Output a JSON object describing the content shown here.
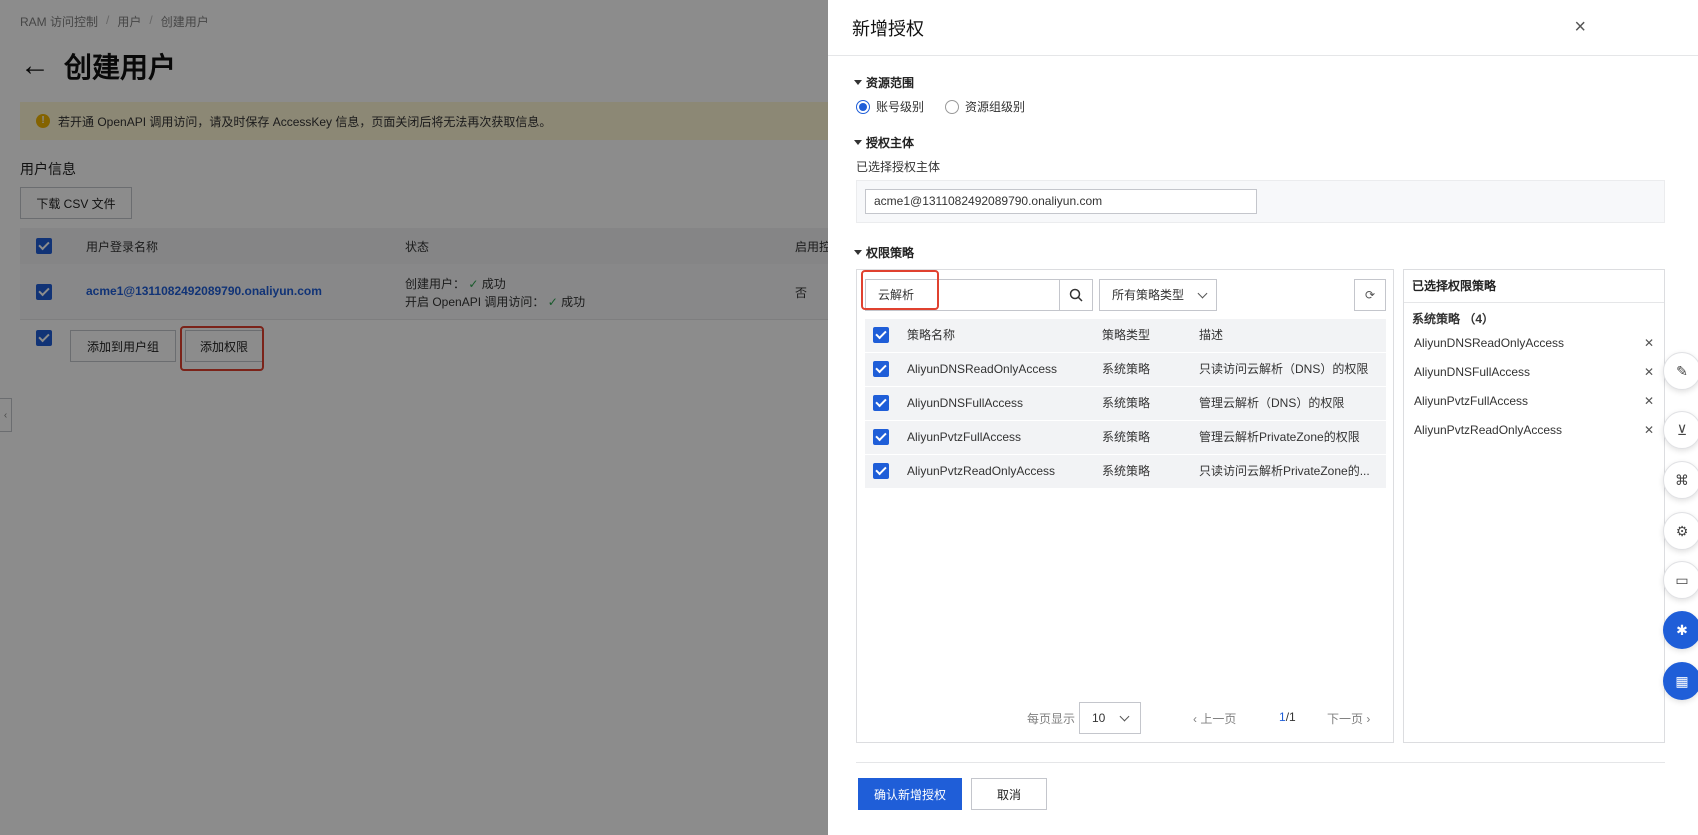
{
  "background": {
    "breadcrumb": [
      "RAM 访问控制",
      "用户",
      "创建用户"
    ],
    "title": "创建用户",
    "notice": "若开通 OpenAPI 调用访问，请及时保存 AccessKey 信息，页面关闭后将无法再次获取信息。",
    "section_label": "用户信息",
    "download_btn": "下载 CSV 文件",
    "table_headers": [
      "用户登录名称",
      "状态",
      "启用控"
    ],
    "row": {
      "login": "acme1@1311082492089790.onaliyun.com",
      "status_create_label": "创建用户：",
      "status_create_value": "成功",
      "status_api_label": "开启 OpenAPI 调用访问：",
      "status_api_value": "成功",
      "enabled": "否"
    },
    "add_group_btn": "添加到用户组",
    "add_perm_btn": "添加权限"
  },
  "drawer": {
    "title": "新增授权",
    "close": "×",
    "scope_title": "资源范围",
    "scope_options": [
      "账号级别",
      "资源组级别"
    ],
    "principal_title": "授权主体",
    "principal_label": "已选择授权主体",
    "principal_value": "acme1@1311082492089790.onaliyun.com",
    "policy_title": "权限策略",
    "search_value": "云解析",
    "type_select": "所有策略类型",
    "refresh": "⟳",
    "table_headers": [
      "策略名称",
      "策略类型",
      "描述"
    ],
    "policies": [
      {
        "name": "AliyunDNSReadOnlyAccess",
        "type": "系统策略",
        "desc": "只读访问云解析（DNS）的权限"
      },
      {
        "name": "AliyunDNSFullAccess",
        "type": "系统策略",
        "desc": "管理云解析（DNS）的权限"
      },
      {
        "name": "AliyunPvtzFullAccess",
        "type": "系统策略",
        "desc": "管理云解析PrivateZone的权限"
      },
      {
        "name": "AliyunPvtzReadOnlyAccess",
        "type": "系统策略",
        "desc": "只读访问云解析PrivateZone的..."
      }
    ],
    "pager": {
      "per_page_label": "每页显示",
      "per_page": "10",
      "prev": "上一页",
      "current": "1",
      "sep_total": "/1",
      "next": "下一页"
    },
    "selected_title": "已选择权限策略",
    "selected_group": "系统策略 （4）",
    "selected": [
      "AliyunDNSReadOnlyAccess",
      "AliyunDNSFullAccess",
      "AliyunPvtzFullAccess",
      "AliyunPvtzReadOnlyAccess"
    ],
    "confirm_btn": "确认新增授权",
    "cancel_btn": "取消"
  },
  "colors": {
    "primary": "#1f5ed8",
    "highlight": "#e0412f"
  }
}
